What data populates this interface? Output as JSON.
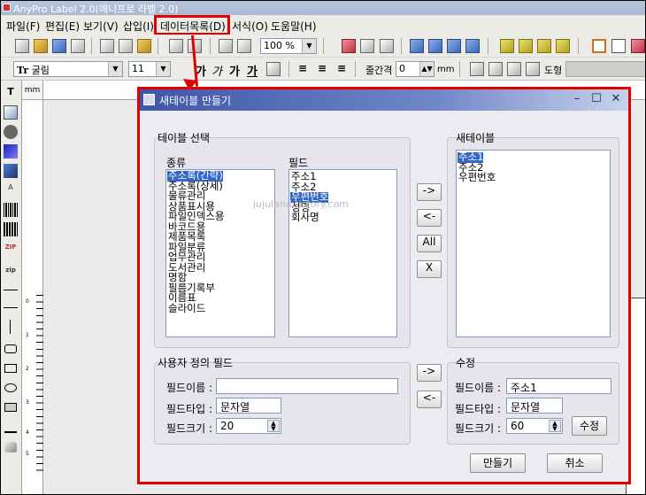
{
  "app": {
    "title": "AnyPro Label 2.0(애니프로 라벨 2.0)"
  },
  "menu": {
    "items": [
      "파일(F)",
      "편집(E)",
      "보기(V)",
      "삽입(I)",
      "데이터목록(D)",
      "서식(O)",
      "도움말(H)"
    ]
  },
  "toolbar1": {
    "zoom": "100 %"
  },
  "toolbar2": {
    "font": "굴림",
    "font_size": "11",
    "spacing_label": "줄간격",
    "spacing_value": "0",
    "unit": "mm",
    "shape_label": "도형"
  },
  "ruler": {
    "unit": "mm",
    "left_ticks": [
      "0",
      "1",
      "2",
      "3",
      "4",
      "5"
    ]
  },
  "dialog": {
    "title": "새테이블 만들기",
    "table_select_group": "테이블 선택",
    "category_label": "종류",
    "categories": [
      "주소록(간략)",
      "주소록(상세)",
      "물류관리",
      "상품표시용",
      "파일인덱스용",
      "바코드용",
      "제품목록",
      "파일분류",
      "업무관리",
      "도서관리",
      "명함",
      "필름기록부",
      "이름표",
      "슬라이드"
    ],
    "selected_category": 0,
    "field_label": "필드",
    "fields": [
      "주소1",
      "주소2",
      "우편번호",
      "성명",
      "회사명"
    ],
    "selected_field": 2,
    "watermark": "jujuland.tistory.com",
    "move_buttons": {
      "add": "->",
      "remove": "<-",
      "all": "All",
      "clear": "X"
    },
    "new_table_group": "새테이블",
    "new_table": [
      "주소1",
      "주소2",
      "우편번호"
    ],
    "selected_new": 0,
    "custom_group": "사용자 정의 필드",
    "edit_group": "수정",
    "field_name_label": "필드이름 :",
    "field_type_label": "필드타입 :",
    "field_size_label": "필드크기 :",
    "custom_name_value": "",
    "custom_type_value": "문자열",
    "custom_size_value": "20",
    "edit_name_value": "주소1",
    "edit_type_value": "문자열",
    "edit_size_value": "60",
    "edit_button": "수정",
    "create_button": "만들기",
    "cancel_button": "취소"
  },
  "colors": {
    "highlight": "#e00000",
    "selection": "#3267c8",
    "dialog_title": "#3f56a8"
  }
}
